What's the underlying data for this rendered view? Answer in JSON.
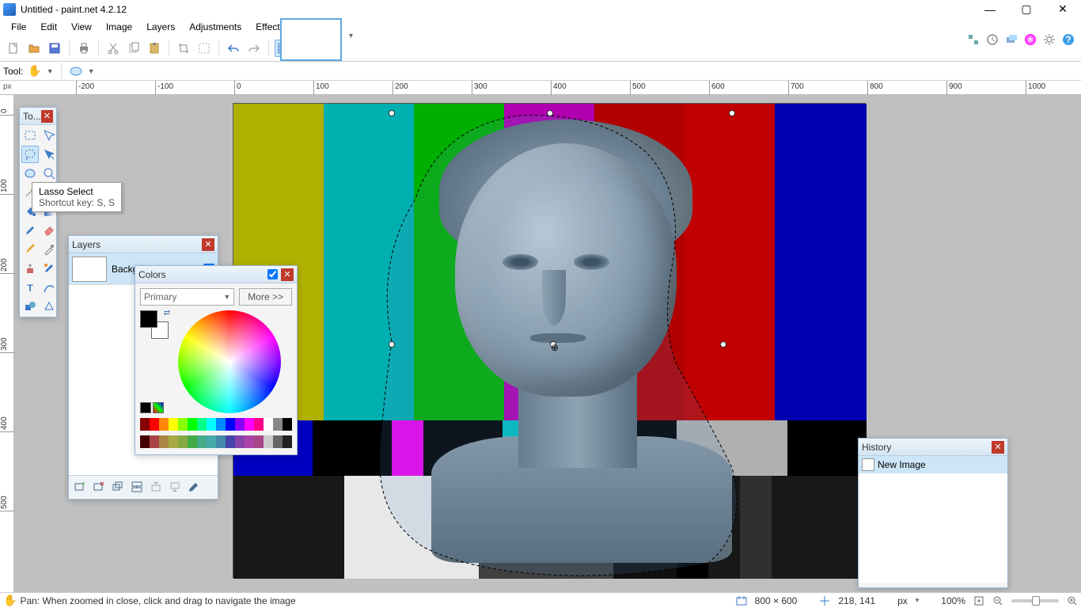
{
  "window": {
    "title": "Untitled - paint.net 4.2.12",
    "minimize": "—",
    "maximize": "▢",
    "close": "✕"
  },
  "menu": {
    "file": "File",
    "edit": "Edit",
    "view": "View",
    "image": "Image",
    "layers": "Layers",
    "adjustments": "Adjustments",
    "effects": "Effects"
  },
  "toolbar": {
    "tool_label": "Tool:"
  },
  "ruler": {
    "unit": "px",
    "hticks": [
      -200,
      -100,
      0,
      100,
      200,
      300,
      400,
      500,
      600,
      700,
      800,
      900,
      1000
    ],
    "vticks": [
      0,
      100,
      200,
      300,
      400,
      500
    ]
  },
  "tools_panel": {
    "title": "To..."
  },
  "tooltip": {
    "title": "Lasso Select",
    "shortcut": "Shortcut key: S, S"
  },
  "layers_panel": {
    "title": "Layers",
    "layer1": "Background"
  },
  "colors_panel": {
    "title": "Colors",
    "primary": "Primary",
    "more": "More >>"
  },
  "history_panel": {
    "title": "History",
    "item1": "New Image"
  },
  "statusbar": {
    "hint": "Pan: When zoomed in close, click and drag to navigate the image",
    "size": "800 × 600",
    "cursor": "218, 141",
    "unit": "px",
    "zoom": "100%"
  }
}
